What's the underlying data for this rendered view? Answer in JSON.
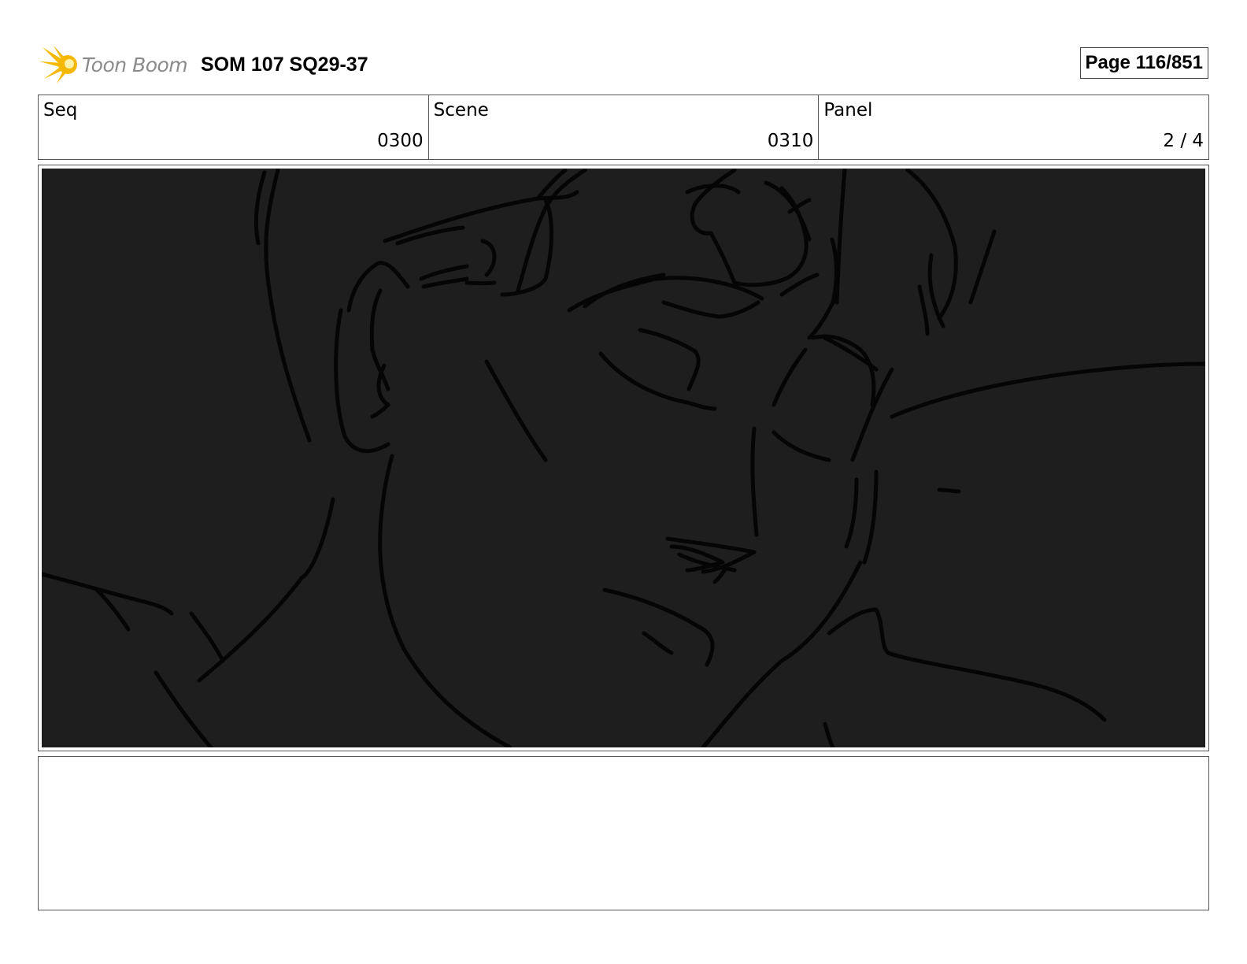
{
  "header": {
    "logo_text": "Toon Boom",
    "title": "SOM 107 SQ29-37",
    "page_label": "Page 116/851"
  },
  "info": {
    "seq_label": "Seq",
    "seq_value": "0300",
    "scene_label": "Scene",
    "scene_value": "0310",
    "panel_label": "Panel",
    "panel_value": "2 / 4"
  },
  "panel": {
    "background_color": "#1e1e1e",
    "line_color": "#050505"
  },
  "notes": {
    "text": ""
  },
  "colors": {
    "logo_burst": "#f5b800",
    "logo_text": "#8a8a8a"
  }
}
